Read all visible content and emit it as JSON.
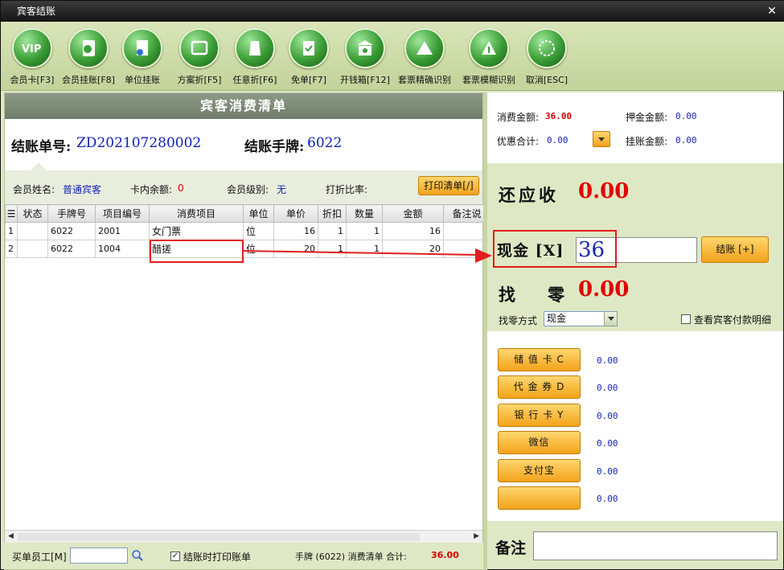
{
  "window": {
    "title": "宾客结账",
    "close_glyph": "✕"
  },
  "toolbar": [
    {
      "label": "会员卡[F3]",
      "icon": "vip-card-icon"
    },
    {
      "label": "会员挂账[F8]",
      "icon": "member-account-icon"
    },
    {
      "label": "单位挂账",
      "icon": "company-account-icon"
    },
    {
      "label": "方案折[F5]",
      "icon": "plan-discount-icon"
    },
    {
      "label": "任意折[F6]",
      "icon": "free-discount-icon"
    },
    {
      "label": "免单[F7]",
      "icon": "free-order-icon"
    },
    {
      "label": "开钱箱[F12]",
      "icon": "cash-drawer-icon"
    },
    {
      "label": "套票精确识别",
      "icon": "ticket-exact-icon"
    },
    {
      "label": "套票模糊识别",
      "icon": "ticket-fuzzy-icon"
    },
    {
      "label": "取消[ESC]",
      "icon": "cancel-icon"
    }
  ],
  "list": {
    "title": "宾客消费清单",
    "bill_no_label": "结账单号:",
    "bill_no": "ZD202107280002",
    "tag_label": "结账手牌:",
    "tag": "6022"
  },
  "member": {
    "name_label": "会员姓名:",
    "name": "普通宾客",
    "balance_label": "卡内余额:",
    "balance": "0",
    "level_label": "会员级别:",
    "level": "无",
    "discount_label": "打折比率:",
    "discount": "",
    "print_button": "打印清单[/]"
  },
  "table": {
    "columns": [
      "☰",
      "状态",
      "手牌号",
      "项目编号",
      "消费项目",
      "单位",
      "单价",
      "折扣",
      "数量",
      "金额",
      "备注说"
    ],
    "rows": [
      [
        "1",
        "",
        "6022",
        "2001",
        "女门票",
        "位",
        "16",
        "1",
        "1",
        "16"
      ],
      [
        "2",
        "",
        "6022",
        "1004",
        "醋搓",
        "位",
        "20",
        "1",
        "1",
        "20"
      ]
    ]
  },
  "bottom": {
    "buyer_label": "买单员工[M]",
    "buyer_value": "",
    "print_on_settle_label": "结账时打印账单",
    "print_on_settle_checked": "✓",
    "summary_prefix": "手牌 (6022) 消费清单 合计:",
    "summary_total": "36.00"
  },
  "summary": {
    "consume_label": "消费金额:",
    "consume": "36.00",
    "deposit_label": "押金金额:",
    "deposit": "0.00",
    "discount_label": "优惠合计:",
    "discount": "0.00",
    "onaccount_label": "挂账金额:",
    "onaccount": "0.00"
  },
  "settle": {
    "due_label": "还应收",
    "due": "0.00",
    "cash_label": "现金 [X]",
    "cash": "36",
    "settle_button": "结账 [+]",
    "change_label": "找零",
    "change": "0.00",
    "change_method_label": "找零方式",
    "change_method": "现金",
    "view_payment_detail": "查看宾客付款明细"
  },
  "payments": [
    {
      "label": "储 值 卡 C",
      "value": "0.00"
    },
    {
      "label": "代 金 券 D",
      "value": "0.00"
    },
    {
      "label": "银 行 卡 Y",
      "value": "0.00"
    },
    {
      "label": "微信",
      "value": "0.00"
    },
    {
      "label": "支付宝",
      "value": "0.00"
    },
    {
      "label": "",
      "value": "0.00"
    }
  ],
  "note": {
    "label": "备注",
    "value": ""
  },
  "colors": {
    "accent": "#f2a21a",
    "highlight": "#e11d1d",
    "value_blue": "#1526b3",
    "amount_red": "#e30000"
  }
}
